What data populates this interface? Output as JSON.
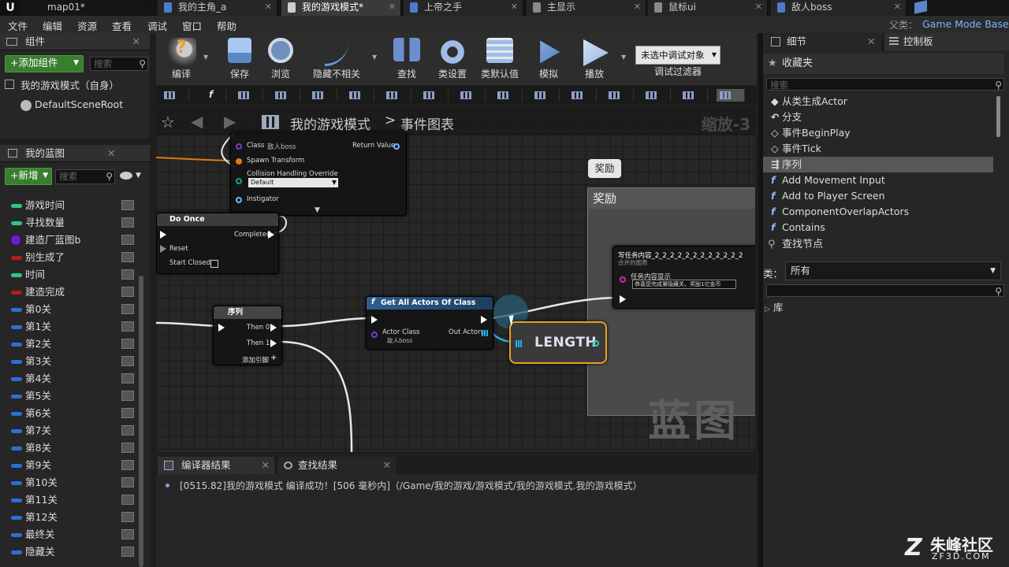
{
  "tabs": [
    {
      "label": "map01*",
      "active": false
    },
    {
      "label": "我的主角_a",
      "active": false
    },
    {
      "label": "我的游戏模式*",
      "active": true
    },
    {
      "label": "上帝之手",
      "active": false
    },
    {
      "label": "主显示",
      "active": false
    },
    {
      "label": "鼠标ui",
      "active": false
    },
    {
      "label": "敌人boss",
      "active": false
    }
  ],
  "parent_class": {
    "label": "父类：",
    "value": "Game Mode Base"
  },
  "menu": [
    "文件",
    "编辑",
    "资源",
    "查看",
    "调试",
    "窗口",
    "帮助"
  ],
  "components": {
    "tab": "组件",
    "add_button": "+添加组件",
    "search_placeholder": "搜索",
    "self_item": "我的游戏模式（自身）",
    "root_item": "DefaultSceneRoot"
  },
  "my_blueprint": {
    "tab": "我的蓝图",
    "new_button": "+新增",
    "search_placeholder": "搜索",
    "variables": [
      {
        "name": "游戏时间",
        "color": "#2ec87a"
      },
      {
        "name": "寻找数量",
        "color": "#2ec87a"
      },
      {
        "name": "建造厂蓝图b",
        "color": "#6a1bd8"
      },
      {
        "name": "别生成了",
        "color": "#b51c1c"
      },
      {
        "name": "时间",
        "color": "#2ec87a"
      },
      {
        "name": "建造完成",
        "color": "#b51c1c"
      },
      {
        "name": "第0关",
        "color": "#2a6fd6"
      },
      {
        "name": "第1关",
        "color": "#2a6fd6"
      },
      {
        "name": "第2关",
        "color": "#2a6fd6"
      },
      {
        "name": "第3关",
        "color": "#2a6fd6"
      },
      {
        "name": "第4关",
        "color": "#2a6fd6"
      },
      {
        "name": "第5关",
        "color": "#2a6fd6"
      },
      {
        "name": "第6关",
        "color": "#2a6fd6"
      },
      {
        "name": "第7关",
        "color": "#2a6fd6"
      },
      {
        "name": "第8关",
        "color": "#2a6fd6"
      },
      {
        "name": "第9关",
        "color": "#2a6fd6"
      },
      {
        "name": "第10关",
        "color": "#2a6fd6"
      },
      {
        "name": "第11关",
        "color": "#2a6fd6"
      },
      {
        "name": "第12关",
        "color": "#2a6fd6"
      },
      {
        "name": "最终关",
        "color": "#2a6fd6"
      },
      {
        "name": "隐藏关",
        "color": "#2a6fd6"
      }
    ]
  },
  "toolbar": {
    "compile": "编译",
    "save": "保存",
    "browse": "浏览",
    "hide": "隐藏不相关",
    "find": "查找",
    "class_settings": "类设置",
    "class_defaults": "类默认值",
    "simulate": "模拟",
    "play": "播放",
    "debug_select": "未选中调试对象",
    "debug_filter": "调试过滤器"
  },
  "graph": {
    "breadcrumb_root": "我的游戏模式",
    "breadcrumb_sep": ">",
    "breadcrumb_leaf": "事件图表",
    "zoom": "缩放-3",
    "watermark": "蓝图",
    "comment_bubble": "奖励",
    "comment_title": "奖励",
    "spawn_node": {
      "class_label": "Class",
      "class_value": "敌人boss",
      "return": "Return Value",
      "spawn_transform": "Spawn Transform",
      "collision": "Collision Handling Override",
      "collision_value": "Default",
      "instigator": "Instigator"
    },
    "do_once": {
      "title": "Do Once",
      "completed": "Completed",
      "reset": "Reset",
      "start_closed": "Start Closed"
    },
    "sequence": {
      "title": "序列",
      "then0": "Then 0",
      "then1": "Then 1",
      "add_pin": "添加引脚"
    },
    "get_all": {
      "title": "Get All Actors Of Class",
      "actor_class": "Actor Class",
      "actor_value": "敌人boss",
      "out_actors": "Out Actors"
    },
    "length": "LENGTH",
    "task_node": {
      "title": "写任务内容_2_2_2_2_2_2_2_2_2_2_2_2",
      "subtitle": "合并的图表",
      "pin_label": "任务内容显示",
      "pin_value": "恭喜您完成第隐藏关，奖励1亿金币"
    }
  },
  "bottom": {
    "tab_compiler": "编译器结果",
    "tab_find": "查找结果",
    "log": "[0515.82]我的游戏模式 编译成功！[506 毫秒内]（/Game/我的游戏/游戏模式/我的游戏模式.我的游戏模式）"
  },
  "right": {
    "tab_details": "细节",
    "tab_palette": "控制板",
    "favorites": "收藏夹",
    "search_placeholder": "搜索",
    "items": [
      {
        "icon": "◆",
        "name": "从类生成Actor",
        "selected": false
      },
      {
        "icon": "↶",
        "name": "分支",
        "selected": false
      },
      {
        "icon": "◇",
        "name": "事件BeginPlay",
        "selected": false
      },
      {
        "icon": "◇",
        "name": "事件Tick",
        "selected": false
      },
      {
        "icon": "⇶",
        "name": "序列",
        "selected": true
      },
      {
        "icon": "f",
        "name": "Add Movement Input",
        "selected": false
      },
      {
        "icon": "f",
        "name": "Add to Player Screen",
        "selected": false
      },
      {
        "icon": "f",
        "name": "ComponentOverlapActors",
        "selected": false
      },
      {
        "icon": "f",
        "name": "Contains",
        "selected": false
      }
    ],
    "find_nodes": "查找节点",
    "category_label": "类：",
    "category_value": "所有",
    "library": "库"
  },
  "brand": {
    "text": "朱峰社区",
    "url": "ZF3D.COM"
  }
}
